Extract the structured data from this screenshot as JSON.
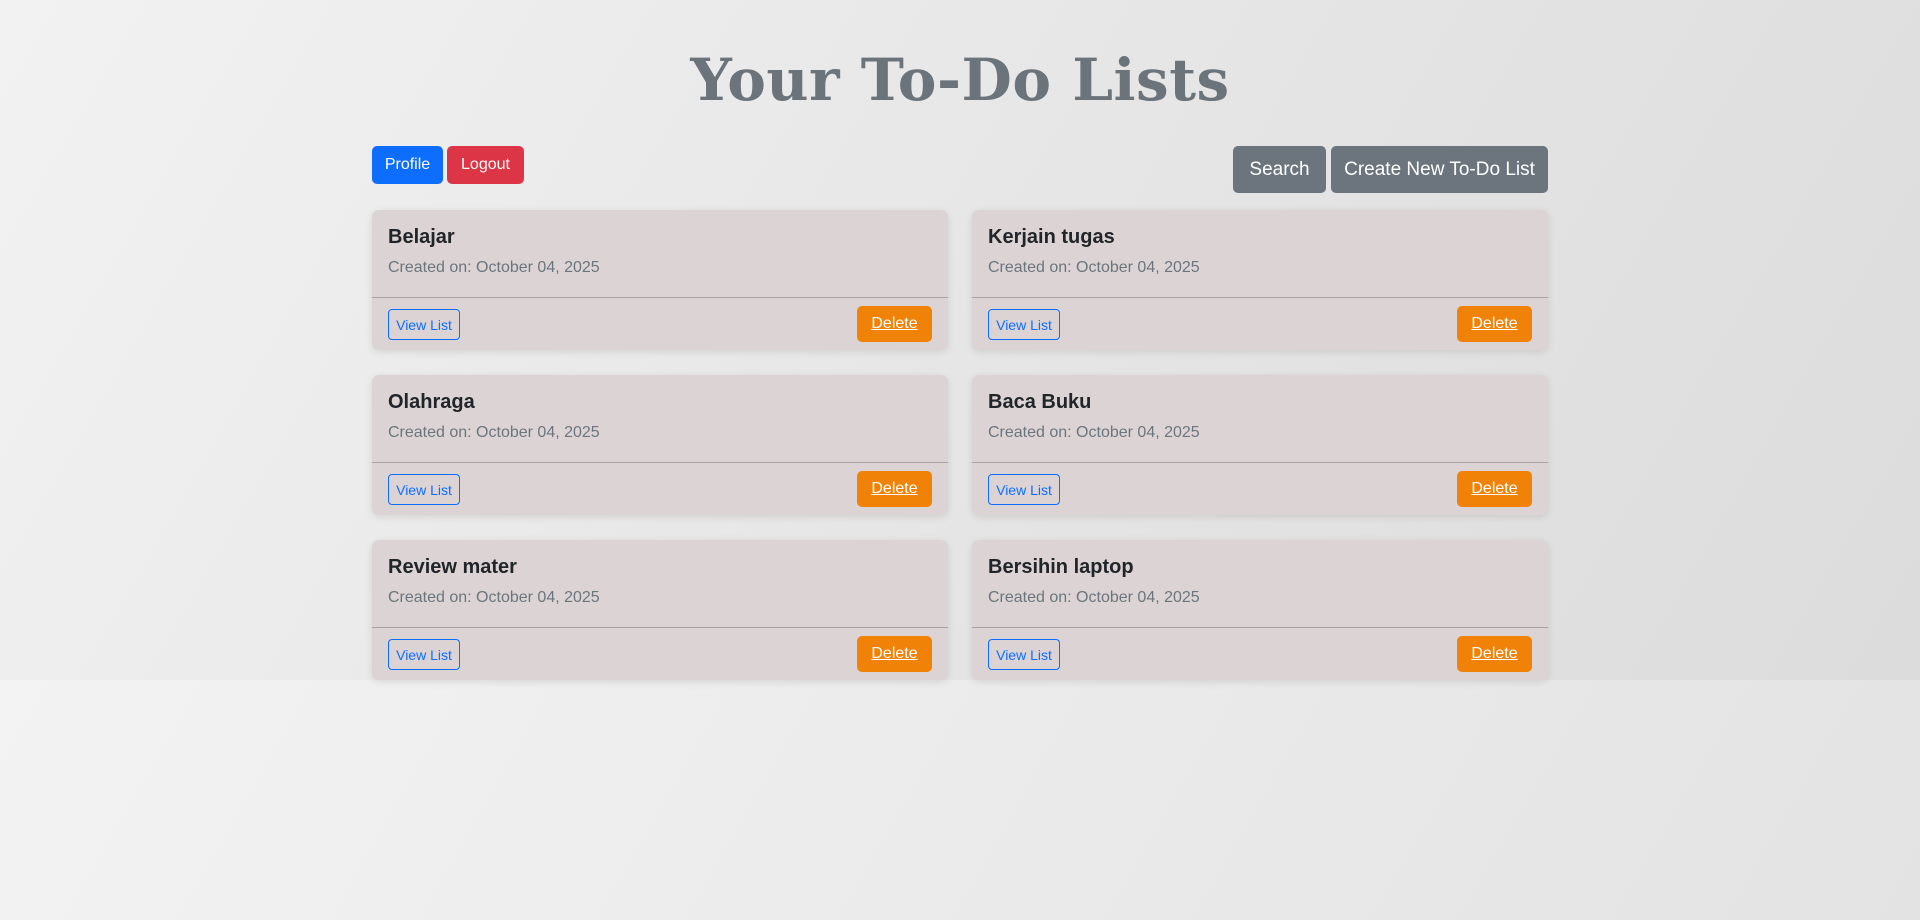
{
  "header": {
    "title": "Your To-Do Lists",
    "profile_label": "Profile",
    "logout_label": "Logout",
    "search_label": "Search",
    "create_label": "Create New To-Do List"
  },
  "lists": [
    {
      "title": "Belajar",
      "created": "Created on: October 04, 2025",
      "view_label": "View List",
      "delete_label": "Delete"
    },
    {
      "title": "Kerjain tugas",
      "created": "Created on: October 04, 2025",
      "view_label": "View List",
      "delete_label": "Delete"
    },
    {
      "title": "Olahraga",
      "created": "Created on: October 04, 2025",
      "view_label": "View List",
      "delete_label": "Delete"
    },
    {
      "title": "Baca Buku",
      "created": "Created on: October 04, 2025",
      "view_label": "View List",
      "delete_label": "Delete"
    },
    {
      "title": "Review mater",
      "created": "Created on: October 04, 2025",
      "view_label": "View List",
      "delete_label": "Delete"
    },
    {
      "title": "Bersihin laptop",
      "created": "Created on: October 04, 2025",
      "view_label": "View List",
      "delete_label": "Delete"
    }
  ],
  "colors": {
    "primary": "#0d6efd",
    "danger": "#dc3545",
    "secondary": "#6c757d",
    "delete": "#f08307",
    "card": "#dcd4d4"
  }
}
